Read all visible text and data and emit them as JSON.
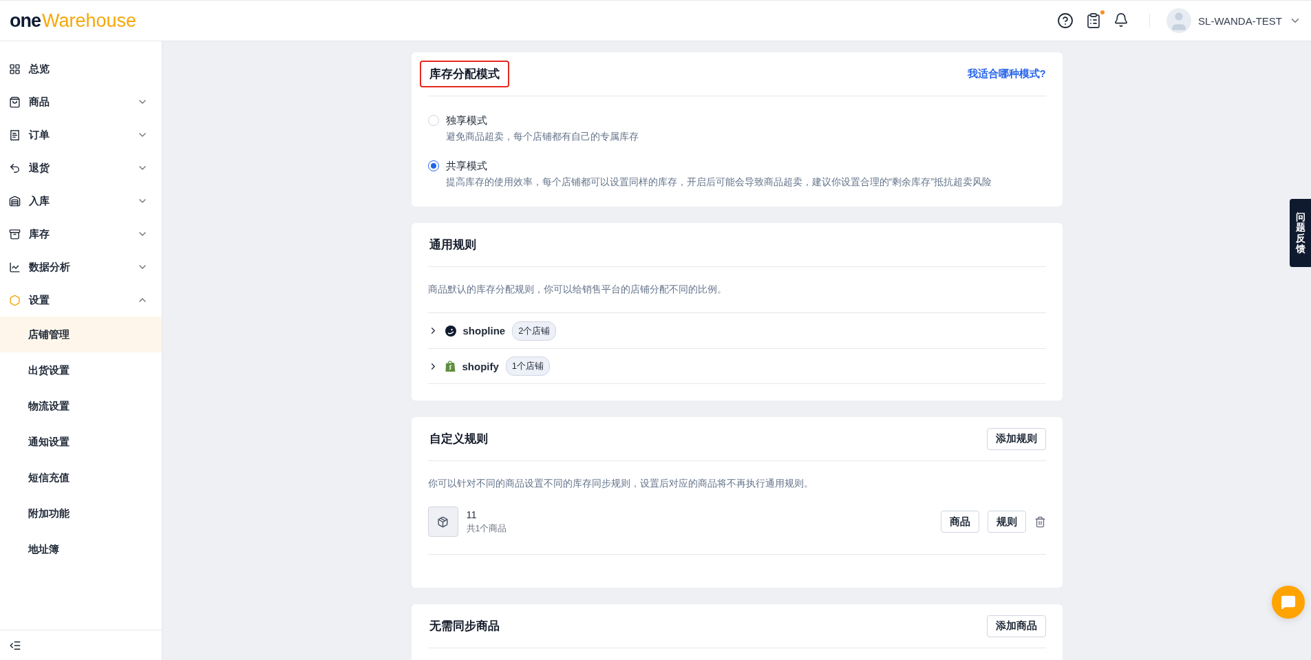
{
  "header": {
    "logo": {
      "part_1": "one",
      "part_2": "Warehouse"
    },
    "tasks_badge": true,
    "user_name": "SL-WANDA-TEST"
  },
  "sidebar": {
    "items": [
      {
        "label": "总览",
        "kind": "link"
      },
      {
        "label": "商品",
        "kind": "group",
        "expanded": false
      },
      {
        "label": "订单",
        "kind": "group",
        "expanded": false
      },
      {
        "label": "退货",
        "kind": "group",
        "expanded": false
      },
      {
        "label": "入库",
        "kind": "group",
        "expanded": false
      },
      {
        "label": "库存",
        "kind": "group",
        "expanded": false
      },
      {
        "label": "数据分析",
        "kind": "group",
        "expanded": false
      },
      {
        "label": "设置",
        "kind": "group",
        "expanded": true,
        "children": [
          {
            "label": "店铺管理",
            "selected": true
          },
          {
            "label": "出货设置",
            "selected": false
          },
          {
            "label": "物流设置",
            "selected": false
          },
          {
            "label": "通知设置",
            "selected": false
          },
          {
            "label": "短信充值",
            "selected": false
          },
          {
            "label": "附加功能",
            "selected": false
          },
          {
            "label": "地址簿",
            "selected": false
          }
        ]
      }
    ]
  },
  "mode_card": {
    "title": "库存分配模式",
    "highlighted": true,
    "help_link": "我适合哪种模式?",
    "options": [
      {
        "label": "独享模式",
        "description": "避免商品超卖，每个店铺都有自己的专属库存",
        "selected": false
      },
      {
        "label": "共享模式",
        "description": "提高库存的使用效率，每个店铺都可以设置同样的库存，开启后可能会导致商品超卖，建议你设置合理的“剩余库存”抵抗超卖风险",
        "selected": true
      }
    ]
  },
  "general_rules": {
    "title": "通用规则",
    "description": "商品默认的库存分配规则，你可以给销售平台的店铺分配不同的比例。",
    "platforms": [
      {
        "name": "shopline",
        "count": "2个店铺",
        "expanded": false
      },
      {
        "name": "shopify",
        "count": "1个店铺",
        "expanded": false
      }
    ]
  },
  "custom_rules": {
    "title": "自定义规则",
    "button": "添加规则",
    "description": "你可以针对不同的商品设置不同的库存同步规则，设置后对应的商品将不再执行通用规则。",
    "rules": [
      {
        "name": "11",
        "count": "共1个商品",
        "buttons": [
          "商品",
          "规则"
        ]
      }
    ]
  },
  "no_sync": {
    "title": "无需同步商品",
    "button": "添加商品"
  },
  "feedback_tab": {
    "label": "问题反馈"
  }
}
